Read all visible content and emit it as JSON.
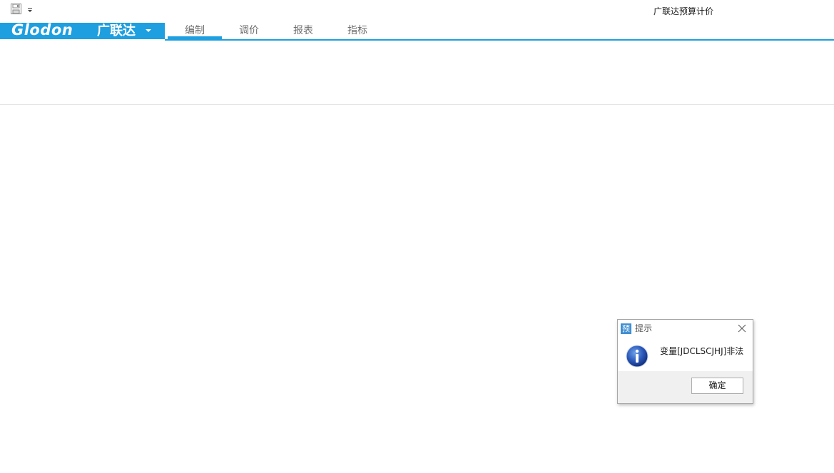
{
  "window": {
    "title": "广联达预算计价"
  },
  "quick_access": {
    "save_icon": "save-icon",
    "customize_icon": "dropdown-icon"
  },
  "app_menu": {
    "logo_text": "Glodon",
    "logo_cn": "广联达",
    "caret_icon": "caret-down-icon"
  },
  "tabs": [
    {
      "label": "编制",
      "active": true
    },
    {
      "label": "调价",
      "active": false
    },
    {
      "label": "报表",
      "active": false
    },
    {
      "label": "指标",
      "active": false
    }
  ],
  "dialog": {
    "app_icon_char": "预",
    "title": "提示",
    "message": "变量[JDCLSCJHJ]非法",
    "ok_label": "确定",
    "info_icon": "info-icon",
    "close_icon": "close-icon"
  },
  "colors": {
    "accent": "#1d9fe0",
    "dialog_footer": "#f0f0f0"
  }
}
